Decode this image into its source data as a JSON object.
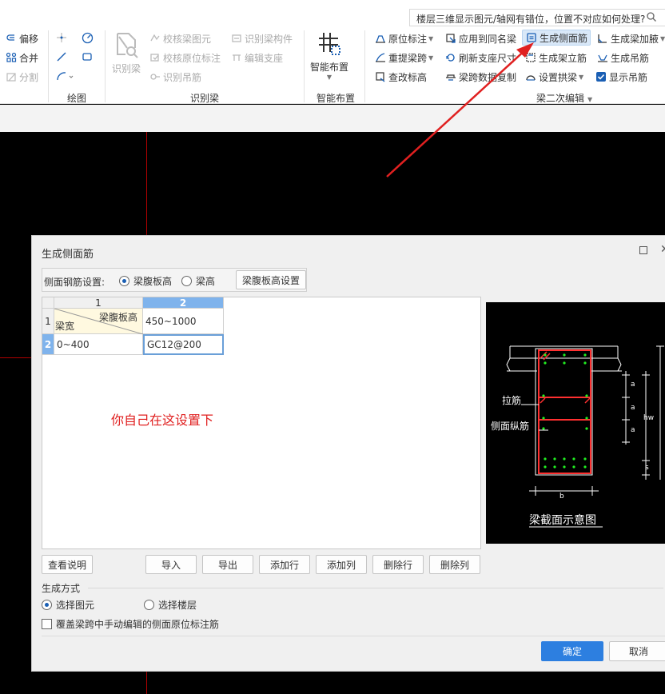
{
  "search": {
    "text": "楼层三维显示图元/轴网有错位，位置不对应如何处理?"
  },
  "ribbon": {
    "draw": {
      "offset": "偏移",
      "merge": "合并",
      "split": "分割",
      "group_label": "绘图"
    },
    "recognize": {
      "big": "识别梁",
      "check_beam_elem": "校核梁图元",
      "check_orig_mark": "校核原位标注",
      "recog_hanger": "识别吊筋",
      "recog_member": "识别梁构件",
      "edit_support": "编辑支座",
      "group_label": "识别梁"
    },
    "smart": {
      "big": "智能布置",
      "group_label": "智能布置"
    },
    "beam_edit": {
      "orig_mark": "原位标注",
      "re_extract_span": "重提梁跨",
      "edit_elev": "查改标高",
      "apply_same_name": "应用到同名梁",
      "refresh_support": "刷新支座尺寸",
      "span_copy": "梁跨数据复制",
      "gen_side_bar": "生成侧面筋",
      "gen_erect_bar": "生成架立筋",
      "set_arch": "设置拱梁",
      "gen_haunch": "生成梁加腋",
      "gen_hanger": "生成吊筋",
      "show_hanger": "显示吊筋",
      "group_label": "梁二次编辑"
    }
  },
  "dialog": {
    "title": "生成侧面筋",
    "side_setting_label": "侧面钢筋设置:",
    "opt_web_height": "梁腹板高",
    "opt_beam_height": "梁高",
    "web_height_setting_btn": "梁腹板高设置",
    "grid": {
      "col_headers": [
        "1",
        "2"
      ],
      "row_headers": [
        "1",
        "2"
      ],
      "corner_top": "梁腹板高",
      "corner_bottom": "梁宽",
      "row1_col2": "450~1000",
      "row2_col1": "0~400",
      "row2_col2": "GC12@200"
    },
    "note": "你自己在这设置下",
    "preview": {
      "label_tie": "拉筋",
      "label_side_long": "侧面纵筋",
      "caption": "梁截面示意图",
      "dim_a": "a",
      "dim_hw": "hw",
      "dim_s": "s",
      "dim_b": "b"
    },
    "buttons": {
      "help": "查看说明",
      "import": "导入",
      "export": "导出",
      "add_row": "添加行",
      "add_col": "添加列",
      "del_row": "删除行",
      "del_col": "删除列",
      "ok": "确定",
      "cancel": "取消"
    },
    "gen_mode_label": "生成方式",
    "mode_select_elem": "选择图元",
    "mode_select_floor": "选择楼层",
    "override_checkbox": "覆盖梁跨中手动编辑的侧面原位标注筋"
  },
  "colors": {
    "accent": "#2d7fe0",
    "annotation": "#e02020",
    "rebar": "#ff3030",
    "rebar_dot": "#22ee22"
  }
}
